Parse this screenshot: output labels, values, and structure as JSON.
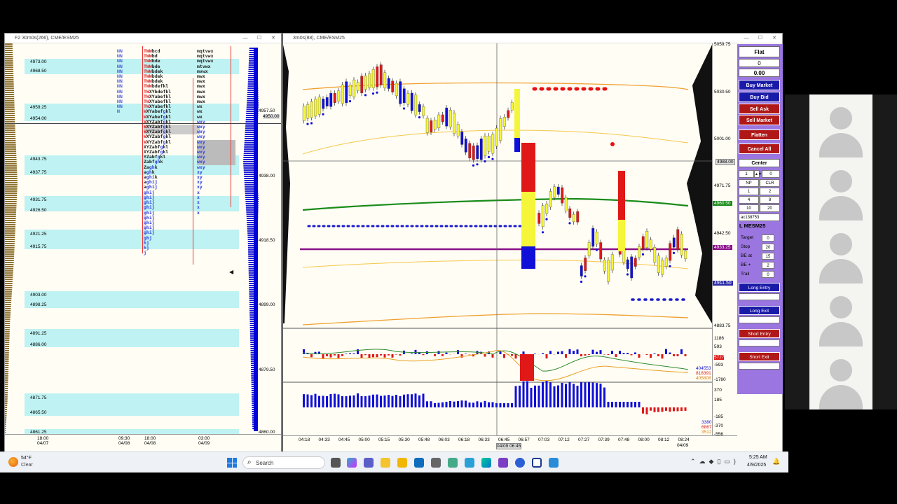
{
  "left_window": {
    "title": "F2 30m0s(266), CME/ESM25",
    "price_labels": [
      "4973.00",
      "4968.50",
      "4959.25",
      "4954.00",
      "4943.75",
      "4937.75",
      "4931.75",
      "4926.50",
      "4921.25",
      "4915.75",
      "4903.00",
      "4898.25",
      "4891.25",
      "4886.00",
      "4871.75",
      "4865.50",
      "4861.25"
    ],
    "right_axis": [
      "4957.50",
      "4950.00",
      "4938.00",
      "4918.50",
      "4899.00",
      "4879.50",
      "4860.00"
    ],
    "time_labels": [
      {
        "t": "18:00",
        "d": "04/07"
      },
      {
        "t": "09:30",
        "d": "04/08"
      },
      {
        "t": "18:00",
        "d": "04/08"
      },
      {
        "t": "03:00",
        "d": "04/09"
      }
    ],
    "tpo_rows": [
      "TWWbcd",
      "TWWbd",
      "TWWbde",
      "TWWbde",
      "TWWbdek",
      "TWWbdek",
      "TWWbdek",
      "TWWbdefkl",
      "TWXYbdefkl",
      "TWXYabefkl",
      "TWXYabefkl",
      "TWXYabefkl",
      "WXYabefgkl",
      "WXYabefgkl",
      "WXYZabfgkl",
      "WXYZabfgkl",
      "WXYZabfgkl",
      "WXYZabfgkl",
      "WXYZabfgkl",
      "XYZabfgkl",
      "XYZabfgkl",
      "YZabfgkl",
      "Zabfghk",
      "Zaghk",
      "aghk",
      "aghik",
      "aghij",
      "aghij",
      "ghij",
      "ghij",
      "ghij",
      "ghij",
      "ghij",
      "ghij",
      "ghij",
      "ghij",
      "ghij",
      "ghj",
      "hj",
      "hj",
      "j"
    ],
    "tpo_right": [
      "mqtvwx",
      "mqtvwx",
      "mqtvwx",
      "mtvwx",
      "mvwx",
      "mwx",
      "mwx",
      "mwx",
      "mwx",
      "mwx",
      "mwx",
      "wx",
      "wx",
      "wx",
      "wxy",
      "wxy",
      "wxy",
      "wxy",
      "wxy",
      "wxy",
      "wxy",
      "wxy",
      "wxy",
      "wxy",
      "xy",
      "xy",
      "xy",
      "xy",
      "x",
      "x",
      "x",
      "x",
      "x"
    ]
  },
  "main_window": {
    "title": "3m0s(88), CME/ESM25",
    "right_axis": [
      "5030.50",
      "5001.00",
      "4988.00",
      "4971.75",
      "4960.50",
      "4942.50",
      "4933.25",
      "4911.50",
      "4883.75"
    ],
    "top_axis": "5059.75",
    "time_labels": [
      "04:18",
      "04:33",
      "04:45",
      "05:00",
      "05:15",
      "05:30",
      "05:48",
      "06:03",
      "06:18",
      "06:33",
      "06:45",
      "06:57",
      "07:03",
      "07:12",
      "07:27",
      "07:39",
      "07:48",
      "08:00",
      "08:12",
      "08:24"
    ],
    "crosshair_time": "04/09 06:45",
    "last_date": "04/09",
    "osc1_axis": [
      "1186",
      "593",
      "5727",
      "-593",
      "-1780"
    ],
    "osc1_values": [
      "404553",
      "818391",
      "405808"
    ],
    "osc2_axis": [
      "370",
      "185",
      "-185",
      "-370",
      "-556"
    ],
    "osc2_values": [
      "3380",
      "6867",
      "3512"
    ]
  },
  "side_panel": {
    "position": "Flat",
    "qty": "0",
    "pnl": "0.00",
    "buttons": {
      "buy_market": "Buy Market",
      "buy_bid": "Buy Bid",
      "sell_ask": "Sell Ask",
      "sell_market": "Sell Market",
      "flatten": "Flatten",
      "cancel_all": "Cancel All",
      "center": "Center"
    },
    "qty_input": "1",
    "qty_input2": "0",
    "grid": [
      [
        "NP",
        "CLR"
      ],
      [
        "1",
        "2"
      ],
      [
        "4",
        "8"
      ],
      [
        "10",
        "20"
      ]
    ],
    "account": "ac138753",
    "symbol": "L MESM25",
    "fields": [
      {
        "label": "Target",
        "value": "0"
      },
      {
        "label": "Stop",
        "value": "20"
      },
      {
        "label": "BE at",
        "value": "15"
      },
      {
        "label": "BE +",
        "value": "2"
      },
      {
        "label": "Trail",
        "value": "0"
      }
    ],
    "long_entry": "Long Entry",
    "long_exit": "Long Exit",
    "short_entry": "Short Entry",
    "short_exit": "Short Exit",
    "colors": {
      "panel": "#9b76e0",
      "blue_btn": "#1a1aa8",
      "red_btn": "#b01818"
    }
  },
  "taskbar": {
    "weather_temp": "54°F",
    "weather_desc": "Clear",
    "search_placeholder": "Search",
    "time": "5:25 AM",
    "date": "4/9/2025"
  }
}
